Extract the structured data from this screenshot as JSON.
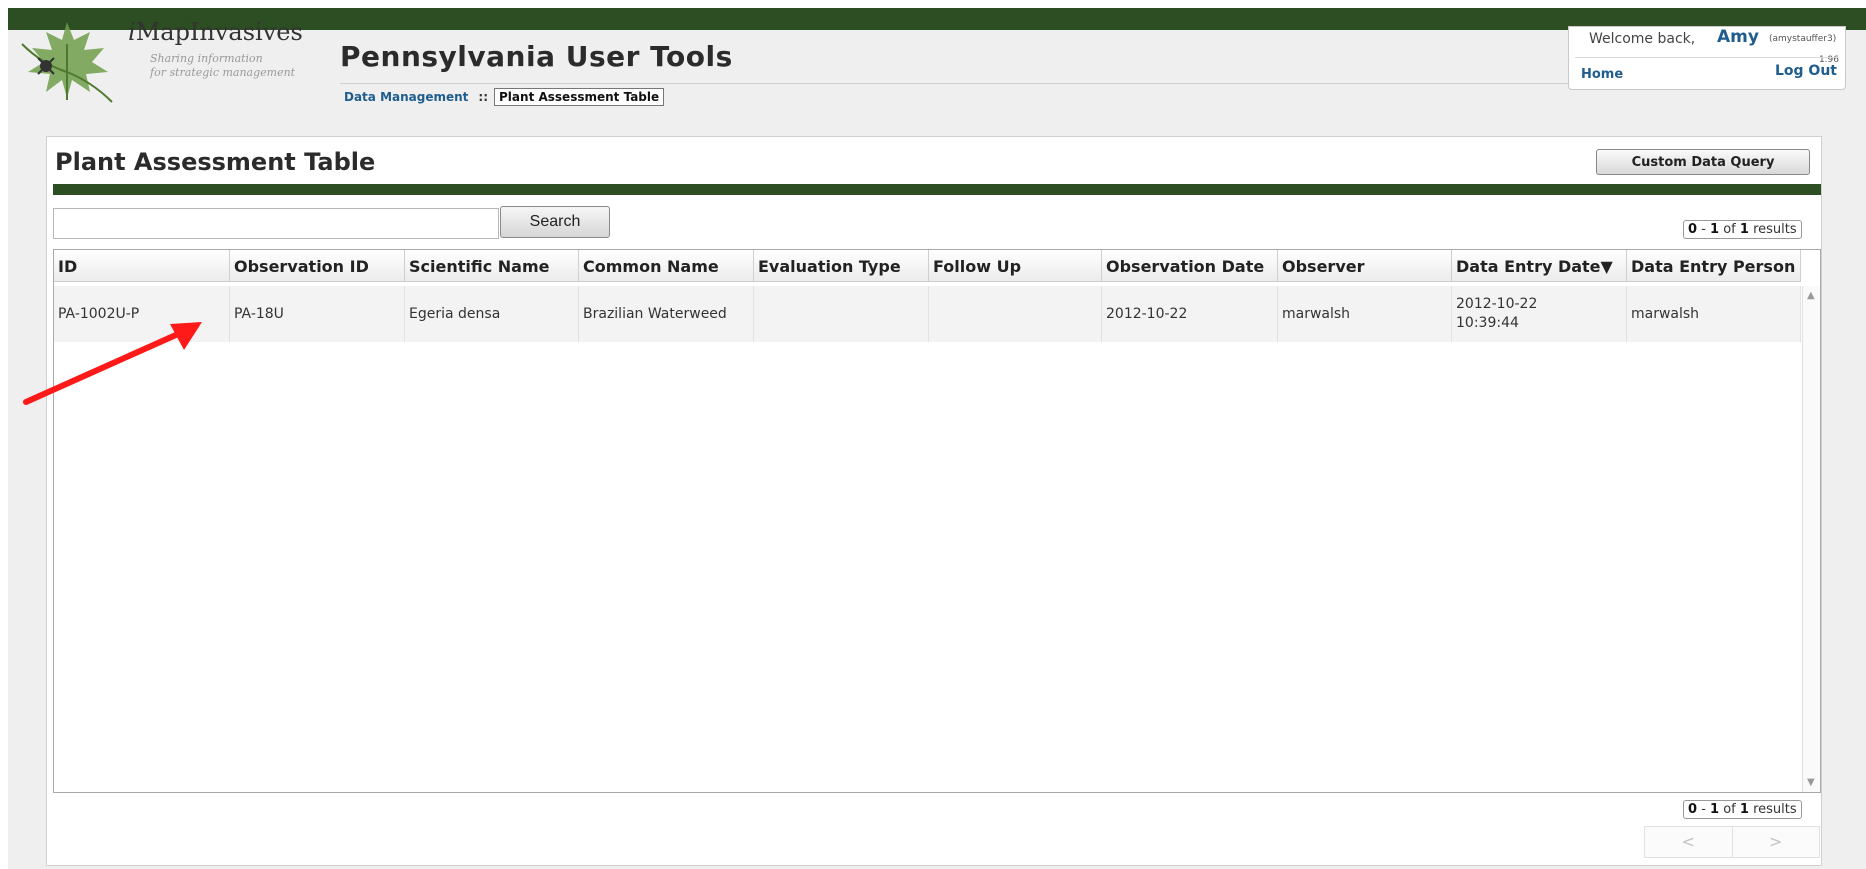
{
  "header": {
    "logo_name_first": "i",
    "logo_name_rest": "MapInvasives",
    "tagline_line1": "Sharing information",
    "tagline_line2": "for strategic management",
    "app_title": "Pennsylvania User Tools",
    "breadcrumb": {
      "link": "Data Management",
      "separator": "::",
      "current": "Plant Assessment Table"
    }
  },
  "user": {
    "welcome": "Welcome back,",
    "first_name": "Amy",
    "username": "(amystauffer3)",
    "version": "1.96",
    "home_label": "Home",
    "logout_label": "Log Out"
  },
  "main": {
    "title": "Plant Assessment Table",
    "custom_query_label": "Custom Data Query",
    "search": {
      "value": "",
      "placeholder": "",
      "button_label": "Search"
    },
    "results": {
      "start": "0",
      "dash": "-",
      "end": "1",
      "of": "of",
      "total": "1",
      "suffix": "results"
    },
    "table": {
      "columns": [
        "ID",
        "Observation ID",
        "Scientific Name",
        "Common Name",
        "Evaluation Type",
        "Follow Up",
        "Observation Date",
        "Observer",
        "Data Entry Date▼",
        "Data Entry Person"
      ],
      "rows": [
        {
          "id": "PA-1002U-P",
          "observation_id": "PA-18U",
          "scientific_name": "Egeria densa",
          "common_name": "Brazilian Waterweed",
          "evaluation_type": "",
          "follow_up": "",
          "observation_date": "2012-10-22",
          "observer": "marwalsh",
          "data_entry_date_line1": "2012-10-22",
          "data_entry_date_line2": "10:39:44",
          "data_entry_person": "marwalsh"
        }
      ]
    },
    "pager": {
      "prev_label": "<",
      "next_label": ">"
    }
  },
  "colors": {
    "top_bar": "#2c4e22",
    "link": "#1f5d8f",
    "annotation_arrow": "#ff1a1a"
  },
  "icons": {
    "logo": "maple-leaf-logo-icon",
    "arrow": "red-arrow-annotation-icon"
  }
}
